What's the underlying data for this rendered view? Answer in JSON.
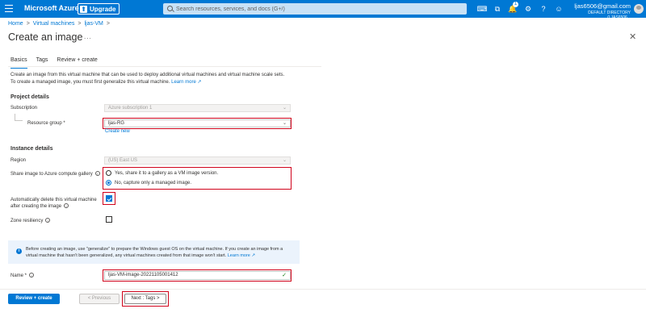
{
  "topbar": {
    "brand": "Microsoft Azure",
    "upgrade_label": "Upgrade",
    "search_placeholder": "Search resources, services, and docs (G+/)",
    "notification_count": "1",
    "user_email": "ljas6506@gmail.com",
    "user_directory": "DEFAULT DIRECTORY (LJAS6506...",
    "icons": [
      "cloud-shell-icon",
      "directory-filter-icon",
      "notifications-icon",
      "settings-icon",
      "help-icon",
      "feedback-icon"
    ]
  },
  "breadcrumb": {
    "items": [
      "Home",
      "Virtual machines",
      "ljas-VM"
    ],
    "separator": ">"
  },
  "page": {
    "title": "Create an image",
    "more": "...",
    "close": "✕"
  },
  "tabs": [
    "Basics",
    "Tags",
    "Review + create"
  ],
  "description": {
    "line1": "Create an image from this virtual machine that can be used to deploy additional virtual machines and virtual machine scale sets.",
    "line2": "To create a managed image, you must first generalize this virtual machine.",
    "link": "Learn more ↗"
  },
  "project_details": {
    "heading": "Project details",
    "subscription_label": "Subscription",
    "subscription_value": "Azure subscription 1",
    "resource_group_label": "Resource group *",
    "resource_group_value": "ljas-RG",
    "create_new": "Create new"
  },
  "instance_details": {
    "heading": "Instance details",
    "region_label": "Region",
    "region_value": "(US) East US",
    "share_label": "Share image to Azure compute gallery",
    "share_options": [
      "Yes, share it to a gallery as a VM image version.",
      "No, capture only a managed image."
    ],
    "share_selected_index": 1,
    "auto_delete_label_1": "Automatically delete this virtual machine",
    "auto_delete_label_2": "after creating the image",
    "auto_delete_checked": true,
    "zone_label": "Zone resiliency",
    "zone_checked": false
  },
  "info_banner": {
    "text": "Before creating an image, use \"generalize\" to prepare the Windows guest OS on the virtual machine. If you create an image from a virtual machine that hasn't been generalized, any virtual machines created from that image won't start.",
    "link": "Learn more ↗"
  },
  "name_field": {
    "label": "Name *",
    "value": "ljas-VM-image-20221105001412"
  },
  "footer": {
    "review_create": "Review + create",
    "previous": "< Previous",
    "next": "Next : Tags >"
  },
  "colors": {
    "accent": "#0078d4",
    "highlight": "#d0021b"
  }
}
